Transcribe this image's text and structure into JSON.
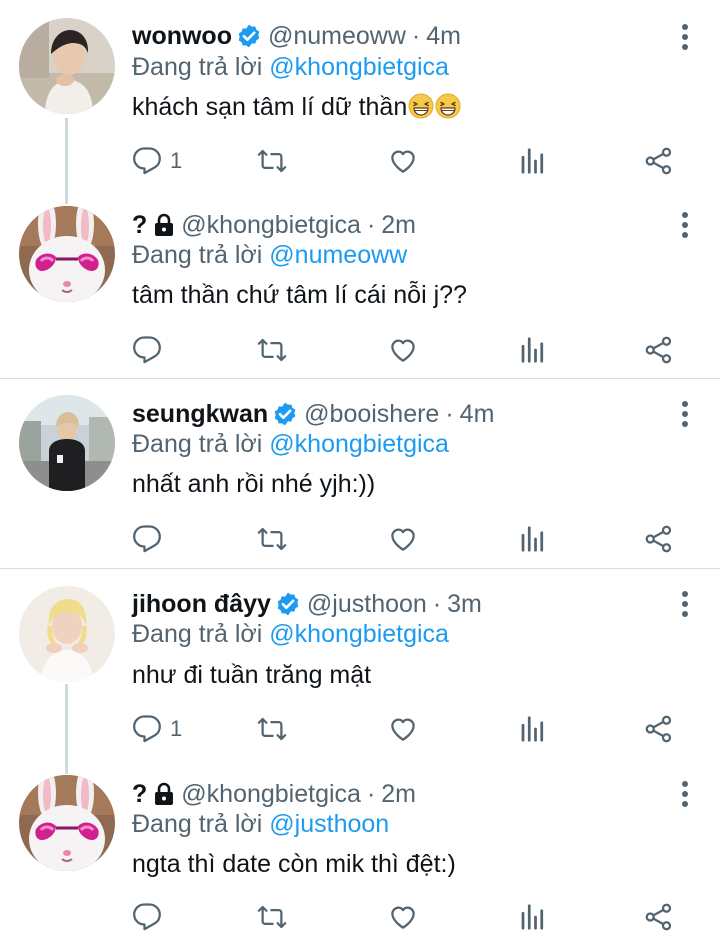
{
  "reply_prefix": "Đang trả lời",
  "colors": {
    "accent": "#1d9bf0",
    "muted": "#536471",
    "text": "#0f1419",
    "divider": "#d7dde1",
    "thread": "#cfd9de"
  },
  "tweets": [
    {
      "name": "wonwoo",
      "verified": true,
      "handle": "@numeoww",
      "time": "4m",
      "reply_to": "@khongbietgica",
      "text": "khách sạn tâm lí dữ thần",
      "emojis": [
        "grinning-squinting-face",
        "grinning-squinting-face"
      ],
      "reply_count": "1",
      "avatar": "portrait-photo"
    },
    {
      "name": "?",
      "locked": true,
      "handle": "@khongbietgica",
      "time": "2m",
      "reply_to": "@numeoww",
      "text": "tâm thần chứ tâm lí cái nỗi j??",
      "reply_count": "",
      "avatar": "rabbit-heart-glasses"
    },
    {
      "name": "seungkwan",
      "verified": true,
      "handle": "@booishere",
      "time": "4m",
      "reply_to": "@khongbietgica",
      "text": "nhất anh rồi nhé yjh:))",
      "reply_count": "",
      "avatar": "street-photo"
    },
    {
      "name": "jihoon đâyy",
      "verified": true,
      "handle": "@justhoon",
      "time": "3m",
      "reply_to": "@khongbietgica",
      "text": "như đi tuần trăng mật",
      "reply_count": "1",
      "avatar": "blonde-portrait"
    },
    {
      "name": "?",
      "locked": true,
      "handle": "@khongbietgica",
      "time": "2m",
      "reply_to": "@justhoon",
      "text": "ngta thì date còn mik thì đệt:)",
      "reply_count": "",
      "avatar": "rabbit-heart-glasses"
    }
  ]
}
